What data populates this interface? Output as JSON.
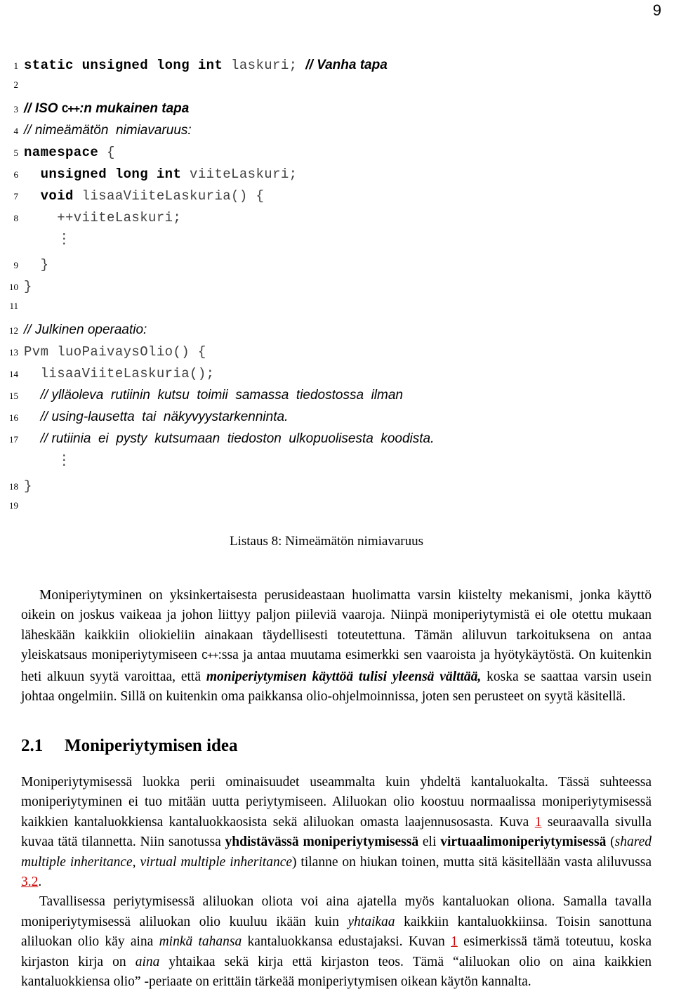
{
  "page": {
    "number": "9"
  },
  "listing": {
    "caption": "Listaus 8: Nimeämätön nimiavaruus",
    "dots_glyph": "⋮",
    "lines": [
      {
        "no": "1",
        "kw": "static unsigned long int ",
        "code": "laskuri; ",
        "comment": "// Vanha tapa"
      },
      {
        "no": "2",
        "kw": "",
        "code": "",
        "comment": ""
      },
      {
        "no": "3",
        "kw": "",
        "code": "",
        "comment": "// ISO C++:n mukainen tapa"
      },
      {
        "no": "4",
        "kw": "",
        "code": "",
        "comment": "// nimeämätön  nimiavaruus:"
      },
      {
        "no": "5",
        "kw": "namespace ",
        "code": "{",
        "comment": ""
      },
      {
        "no": "6",
        "kw": "  unsigned long int ",
        "code": "viiteLaskuri;",
        "comment": ""
      },
      {
        "no": "7",
        "kw": "  void ",
        "code": "lisaaViiteLaskuria() {",
        "comment": ""
      },
      {
        "no": "8",
        "kw": "",
        "code": "    ++viiteLaskuri;",
        "comment": ""
      },
      {
        "no": "9",
        "kw": "",
        "code": "  }",
        "comment": ""
      },
      {
        "no": "10",
        "kw": "",
        "code": "}",
        "comment": ""
      },
      {
        "no": "11",
        "kw": "",
        "code": "",
        "comment": ""
      },
      {
        "no": "12",
        "kw": "",
        "code": "",
        "comment": "// Julkinen operaatio:"
      },
      {
        "no": "13",
        "kw": "",
        "code": "Pvm luoPaivaysOlio() {",
        "comment": ""
      },
      {
        "no": "14",
        "kw": "",
        "code": "  lisaaViiteLaskuria();",
        "comment": ""
      },
      {
        "no": "15",
        "kw": "",
        "code": "  ",
        "comment": "// ylläoleva rutiinin kutsu toimii samassa tiedostossa ilman"
      },
      {
        "no": "16",
        "kw": "",
        "code": "  ",
        "comment": "// using-lausetta tai näkyvyystarkenninta."
      },
      {
        "no": "17",
        "kw": "",
        "code": "  ",
        "comment": "// rutiinia ei pysty kutsumaan tiedoston ulkopuolisesta koodista."
      },
      {
        "no": "18",
        "kw": "",
        "code": "}",
        "comment": ""
      },
      {
        "no": "19",
        "kw": "",
        "code": "",
        "comment": ""
      }
    ]
  },
  "intro_paragraph": {
    "t1": "Moniperiytyminen on yksinkertaisesta perusideastaan huolimatta varsin kiistelty mekanismi, jonka käyttö oikein on joskus vaikeaa ja johon liittyy paljon piileviä vaaroja. Niinpä moniperiytymistä ei ole otettu mukaan läheskään kaikkiin oliokieliin ainakaan täydellisesti toteutettuna. Tämän aliluvun tarkoituksena on antaa yleiskatsaus moniperiytymiseen ",
    "cpp": "C++",
    "t2": ":ssa ja antaa muutama esimerkki sen vaaroista ja hyötykäytöstä. On kuitenkin heti alkuun syytä varoittaa, että ",
    "em1": "moniperiytymisen käyttöä tulisi yleensä välttää,",
    "t3": " koska se saattaa varsin usein johtaa ongelmiin. Sillä on kuitenkin oma paikkansa olio-ohjelmoinnissa, joten sen perusteet on syytä käsitellä."
  },
  "section": {
    "number": "2.1",
    "title": "Moniperiytymisen idea"
  },
  "idea_paragraph": {
    "p1a": "Moniperiytymisessä luokka perii ominaisuudet useammalta kuin yhdeltä kantaluokalta. Tässä suhteessa moniperiytyminen ei tuo mitään uutta periytymiseen. Aliluokan olio koostuu normaalissa moniperiytymisessä kaikkien kantaluokkiensa kantaluokkaosista sekä aliluokan omasta laajennusosasta. Kuva ",
    "ref1": "1",
    "p1b": " seuraavalla sivulla kuvaa tätä tilannetta. Niin sanotussa ",
    "b1": "yhdistävässä moniperiytymisessä",
    "p1c": " eli ",
    "b2": "virtuaalimoniperiytymisessä",
    "p1d": " (",
    "i1": "shared multiple inheritance, virtual multiple inheritance",
    "p1e": ") tilanne on hiukan toinen, mutta sitä käsitellään vasta aliluvussa ",
    "ref2": "3.2",
    "p1f": ".",
    "p2a": "Tavallisessa periytymisessä aliluokan oliota voi aina ajatella myös kantaluokan oliona. Samalla tavalla moniperiytymisessä aliluokan olio kuuluu ikään kuin ",
    "i2": "yhtaikaa",
    "p2b": " kaikkiin kantaluokkiinsa. Toisin sanottuna aliluokan olio käy aina ",
    "i3": "minkä tahansa",
    "p2c": " kantaluokkansa edustajaksi. Kuvan ",
    "ref3": "1",
    "p2d": " esimerkissä tämä toteutuu, koska kirjaston kirja on ",
    "i4": "aina",
    "p2e": " yhtaikaa sekä kirja että kirjaston teos. Tämä “aliluokan olio on aina kaikkien kantaluokkiensa olio” -periaate on erittäin tärkeää moniperiytymisen oikean käytön kannalta."
  },
  "colors": {
    "link": "#cc0000",
    "code_plain": "#3f3f3f",
    "text": "#000000",
    "background": "#ffffff"
  }
}
